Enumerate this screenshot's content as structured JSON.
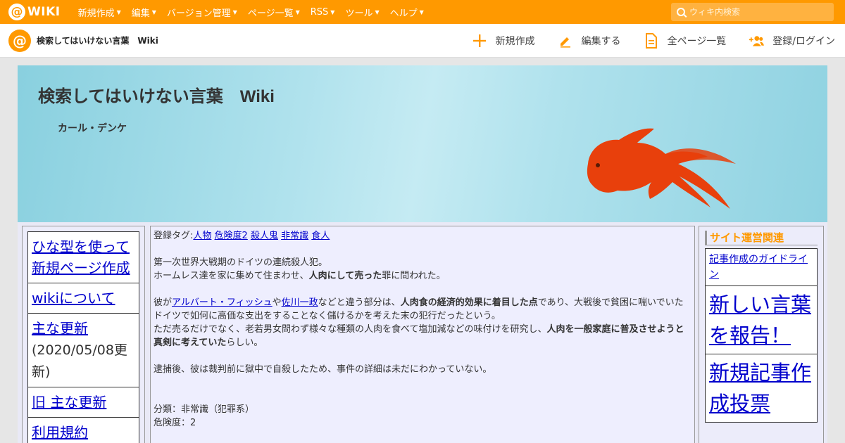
{
  "topbar": {
    "logo_at": "@",
    "logo_text": "WIKI",
    "menu": [
      "新規作成",
      "編集",
      "バージョン管理",
      "ページ一覧",
      "RSS",
      "ツール",
      "ヘルプ"
    ],
    "search_placeholder": "ウィキ内検索"
  },
  "subbar": {
    "site_logo": "@",
    "site_name": "検索してはいけない言葉　Wiki",
    "actions": [
      "新規作成",
      "編集する",
      "全ページ一覧",
      "登録/ログイン"
    ]
  },
  "banner": {
    "title": "検索してはいけない言葉　Wiki",
    "subtitle": "カール・デンケ"
  },
  "left_menu": {
    "items": [
      "ひな型を使って新規ページ作成",
      "wikiについて",
      "主な更新",
      "旧 主な更新",
      "利用規約"
    ],
    "update_date": "(2020/05/08更新)"
  },
  "article": {
    "tags_label": "登録タグ:",
    "tags": [
      "人物",
      "危険度2",
      "殺人鬼",
      "非常識",
      "食人"
    ],
    "line1": "第一次世界大戦期のドイツの連続殺人犯。",
    "line2_pre": "ホームレス達を家に集めて住まわせ、",
    "line2_bold": "人肉にして売った",
    "line2_post": "罪に問われた。",
    "p2_pre": "彼が",
    "p2_link1": "アルバート・フィッシュ",
    "p2_mid": "や",
    "p2_link2": "佐川一政",
    "p2_mid2": "などと違う部分は、",
    "p2_bold": "人肉食の経済的効果に着目した点",
    "p2_post": "であり、大戦後で貧困に喘いでいたドイツで如何に高価な支出をすることなく儲けるかを考えた末の犯行だったという。",
    "p3_pre": "ただ売るだけでなく、老若男女問わず様々な種類の人肉を食べて塩加減などの味付けを研究し、",
    "p3_bold": "人肉を一般家庭に普及させようと真剣に考えていた",
    "p3_post": "らしい。",
    "p4": "逮捕後、彼は裁判前に獄中で自殺したため、事件の詳細は未だにわかっていない。",
    "category": "分類：非常識（犯罪系）",
    "danger": "危険度：2"
  },
  "right_menu": {
    "heading": "サイト運営関連",
    "items": [
      "記事作成のガイドライン",
      "新しい言葉を報告！",
      "新規記事作成投票"
    ]
  }
}
